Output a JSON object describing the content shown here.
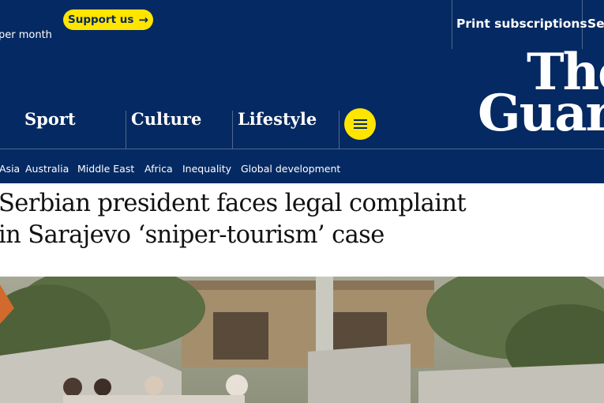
{
  "top_bar": {
    "per_month": "per month",
    "support_label": "Support us",
    "support_arrow": "→",
    "print_subscriptions": "Print subscriptions",
    "search": "Sea"
  },
  "nav": {
    "sport": "Sport",
    "culture": "Culture",
    "lifestyle": "Lifestyle",
    "logo_line1": "The",
    "logo_line2": "Guar"
  },
  "subnav": [
    "Asia",
    "Australia",
    "Middle East",
    "Africa",
    "Inequality",
    "Global development"
  ],
  "article": {
    "headline_line1": "Serbian president faces legal complaint",
    "headline_line2": "in Sarajevo ‘sniper-tourism’ case"
  },
  "colors": {
    "brand_blue": "#052962",
    "accent_yellow": "#ffe500",
    "divider": "#506991"
  },
  "icons": {
    "menu": "hamburger-menu-icon",
    "support_arrow": "arrow-right-icon"
  }
}
